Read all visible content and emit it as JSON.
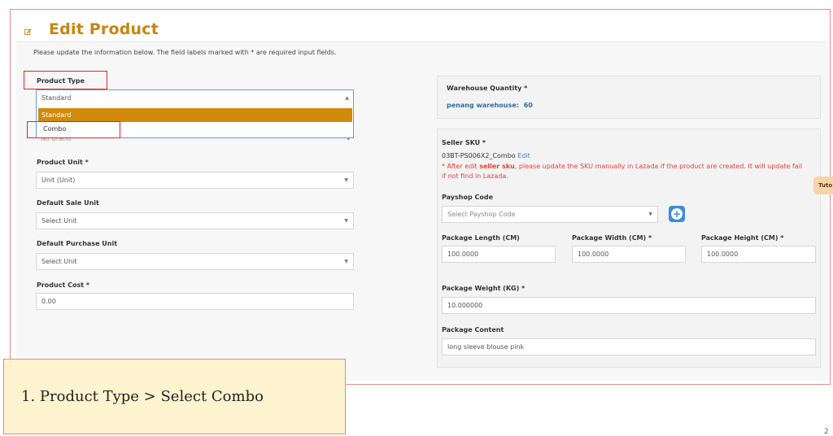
{
  "header": {
    "title": "Edit Product",
    "title_icon": "edit-icon",
    "intro": "Please update the information below. The field labels marked with * are required input fields."
  },
  "left_form": {
    "product_type": {
      "label": "Product Type",
      "value": "Standard",
      "options": [
        "Standard",
        "Combo"
      ],
      "highlighted": "Standard"
    },
    "brand": {
      "value": "No Brand"
    },
    "product_unit": {
      "label": "Product Unit *",
      "value": "Unit (Unit)"
    },
    "default_sale_unit": {
      "label": "Default Sale Unit",
      "value": "Select Unit"
    },
    "default_purchase_unit": {
      "label": "Default Purchase Unit",
      "value": "Select Unit"
    },
    "product_cost": {
      "label": "Product Cost *",
      "value": "0.00"
    }
  },
  "right_form": {
    "warehouse": {
      "label": "Warehouse Quantity *",
      "name": "penang warehouse:",
      "qty": "60"
    },
    "seller_sku": {
      "label": "Seller SKU *",
      "value": "03BT-PS006X2_Combo",
      "edit_link": "Edit",
      "warn_pre": "* After edit ",
      "warn_bold": "seller sku",
      "warn_post": ", please update the SKU manually in Lazada if the product are created. It will update fail if not find in Lazada."
    },
    "payshop": {
      "label": "Payshop Code",
      "placeholder": "Select Payshop Code"
    },
    "package_length": {
      "label": "Package Length (CM)",
      "value": "100.0000"
    },
    "package_width": {
      "label": "Package Width (CM) *",
      "value": "100.0000"
    },
    "package_height": {
      "label": "Package Height (CM) *",
      "value": "100.0000"
    },
    "package_weight": {
      "label": "Package Weight (KG) *",
      "value": "10.000000"
    },
    "package_content": {
      "label": "Package Content",
      "value": "long sleeve blouse pink"
    }
  },
  "side_tab": {
    "label": "Tuto"
  },
  "caption": {
    "text": "1. Product Type > Select Combo"
  },
  "corner": {
    "text": "2"
  },
  "colors": {
    "title": "#c7850f",
    "highlight": "#d08a0c",
    "annotation": "#e52323",
    "caption_bg": "#fdf3cf",
    "link": "#3d86c6",
    "warning": "#e0413d"
  }
}
